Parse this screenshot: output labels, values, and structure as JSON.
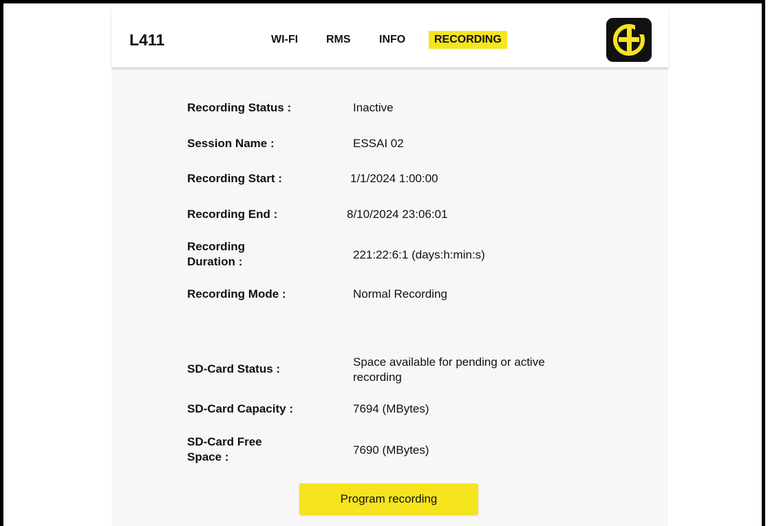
{
  "header": {
    "device_name": "L411",
    "tabs": [
      {
        "label": "WI-FI",
        "active": false
      },
      {
        "label": "RMS",
        "active": false
      },
      {
        "label": "INFO",
        "active": false
      },
      {
        "label": "RECORDING",
        "active": true
      }
    ],
    "logo_icon": "ca-logo-icon"
  },
  "recording": {
    "status_label": "Recording Status :",
    "status_value": "Inactive",
    "session_label": "Session Name :",
    "session_value": "ESSAI 02",
    "start_label": "Recording Start :",
    "start_value": "1/1/2024 1:00:00",
    "end_label": "Recording End :",
    "end_value": "8/10/2024 23:06:01",
    "duration_label_line1": "Recording",
    "duration_label_line2": "Duration :",
    "duration_value": "221:22:6:1 (days:h:min:s)",
    "mode_label": "Recording Mode :",
    "mode_value": "Normal Recording"
  },
  "sdcard": {
    "status_label": "SD-Card Status :",
    "status_value_line1": "Space available for pending or active",
    "status_value_line2": "recording",
    "capacity_label": "SD-Card Capacity :",
    "capacity_value": "7694 (MBytes)",
    "free_label_line1": "SD-Card Free",
    "free_label_line2": "Space :",
    "free_value": "7690 (MBytes)"
  },
  "actions": {
    "program_label": "Program recording"
  },
  "colors": {
    "accent": "#f5e41e",
    "logo_bg": "#111111",
    "panel_bg": "#f7f7f7"
  }
}
